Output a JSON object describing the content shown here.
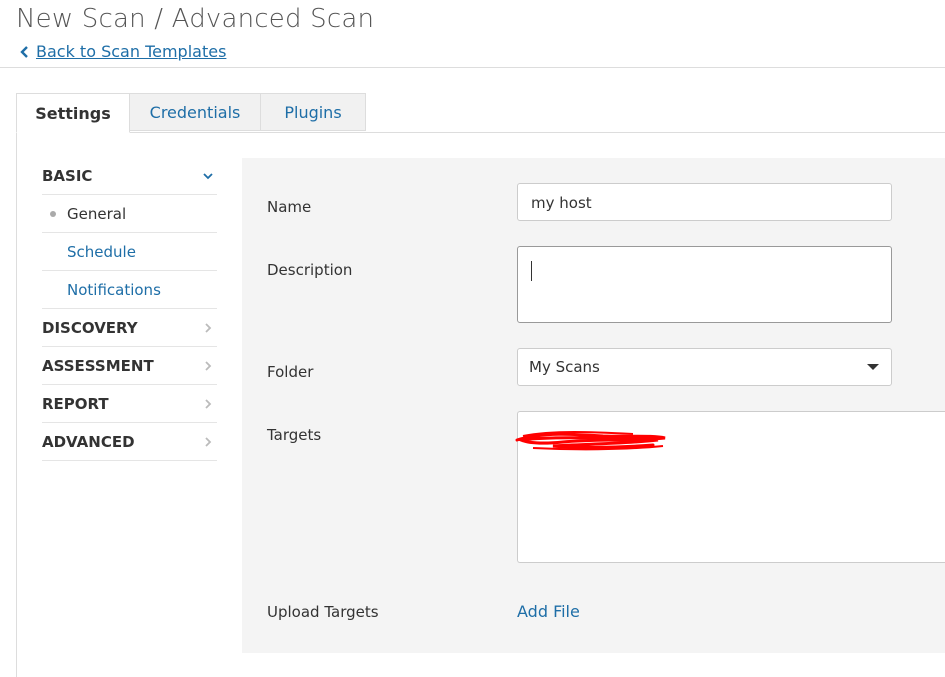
{
  "header": {
    "title": "New Scan / Advanced Scan",
    "back_link": "Back to Scan Templates"
  },
  "tabs": [
    {
      "label": "Settings",
      "active": true
    },
    {
      "label": "Credentials",
      "active": false
    },
    {
      "label": "Plugins",
      "active": false
    }
  ],
  "sidebar": {
    "basic": {
      "label": "BASIC",
      "icon": "chevron-down-icon",
      "items": [
        {
          "label": "General",
          "current": true
        },
        {
          "label": "Schedule",
          "current": false
        },
        {
          "label": "Notifications",
          "current": false
        }
      ]
    },
    "sections": [
      {
        "label": "DISCOVERY",
        "icon": "chevron-right-icon"
      },
      {
        "label": "ASSESSMENT",
        "icon": "chevron-right-icon"
      },
      {
        "label": "REPORT",
        "icon": "chevron-right-icon"
      },
      {
        "label": "ADVANCED",
        "icon": "chevron-right-icon"
      }
    ]
  },
  "form": {
    "name_label": "Name",
    "name_value": "my host",
    "description_label": "Description",
    "description_value": "",
    "folder_label": "Folder",
    "folder_value": "My Scans",
    "targets_label": "Targets",
    "targets_value": "",
    "upload_label": "Upload Targets",
    "add_file": "Add File"
  },
  "colors": {
    "accent": "#1e6ea7",
    "panel_bg": "#f4f4f4",
    "redaction": "#ff0000"
  }
}
